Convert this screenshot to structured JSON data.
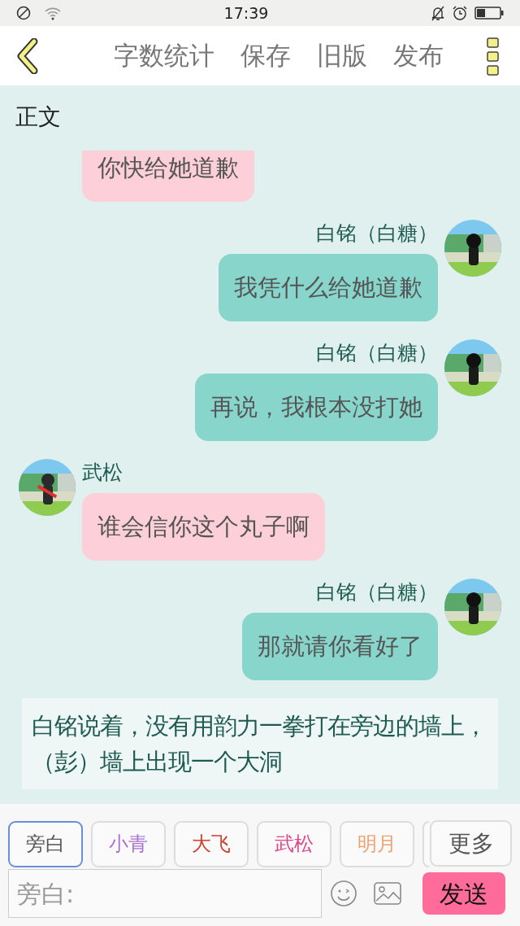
{
  "status_bar": {
    "time": "17:39"
  },
  "toolbar": {
    "actions": [
      "字数统计",
      "保存",
      "旧版",
      "发布"
    ]
  },
  "section_title": "正文",
  "messages": [
    {
      "kind": "left",
      "text": "你快给她道歉"
    },
    {
      "kind": "right",
      "speaker": "白铭（白糖）",
      "text": "我凭什么给她道歉"
    },
    {
      "kind": "right",
      "speaker": "白铭（白糖）",
      "text": "再说，我根本没打她"
    },
    {
      "kind": "left",
      "speaker": "武松",
      "text": "谁会信你这个丸子啊"
    },
    {
      "kind": "right",
      "speaker": "白铭（白糖）",
      "text": "那就请你看好了"
    },
    {
      "kind": "narration",
      "text": "白铭说着，没有用韵力一拳打在旁边的墙上，（彭）墙上出现一个大洞"
    }
  ],
  "characters": [
    {
      "label": "旁白",
      "selected": true,
      "color": "#555555"
    },
    {
      "label": "小青",
      "selected": false,
      "color": "#a872d2"
    },
    {
      "label": "大飞",
      "selected": false,
      "color": "#d2402c"
    },
    {
      "label": "武松",
      "selected": false,
      "color": "#e0458a"
    },
    {
      "label": "明月",
      "selected": false,
      "color": "#eea070"
    }
  ],
  "more_button": "更多",
  "input": {
    "placeholder": "旁白:"
  },
  "send_button": "发送"
}
